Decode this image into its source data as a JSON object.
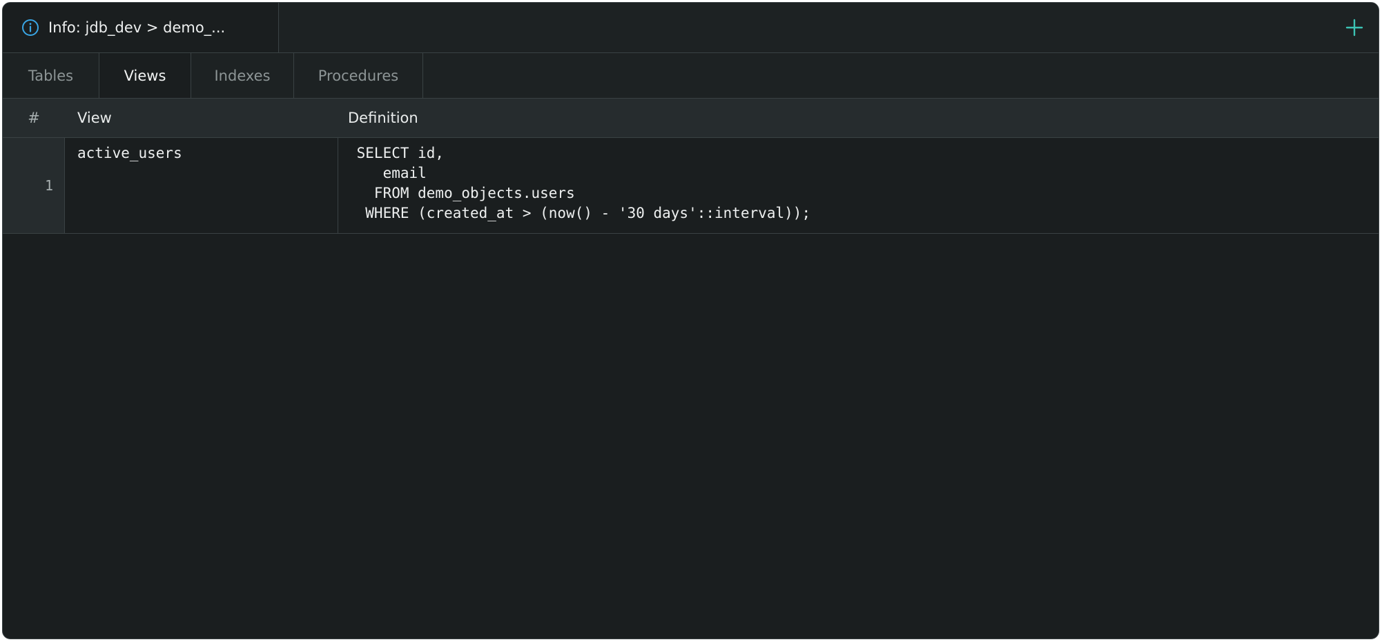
{
  "document_tab": {
    "title": "Info: jdb_dev > demo_...",
    "icon": "info-icon",
    "add_icon": "plus-icon"
  },
  "colors": {
    "accent": "#3aa7e6",
    "add_button": "#3cc3b4",
    "background": "#1a1e1f",
    "header_background": "#262c2e",
    "border": "#3a4244"
  },
  "subtabs": [
    {
      "label": "Tables",
      "active": false
    },
    {
      "label": "Views",
      "active": true
    },
    {
      "label": "Indexes",
      "active": false
    },
    {
      "label": "Procedures",
      "active": false
    }
  ],
  "grid": {
    "columns": {
      "number": "#",
      "view": "View",
      "definition": "Definition"
    },
    "rows": [
      {
        "number": "1",
        "view": "active_users",
        "definition": " SELECT id,\n    email\n   FROM demo_objects.users\n  WHERE (created_at > (now() - '30 days'::interval));"
      }
    ]
  }
}
